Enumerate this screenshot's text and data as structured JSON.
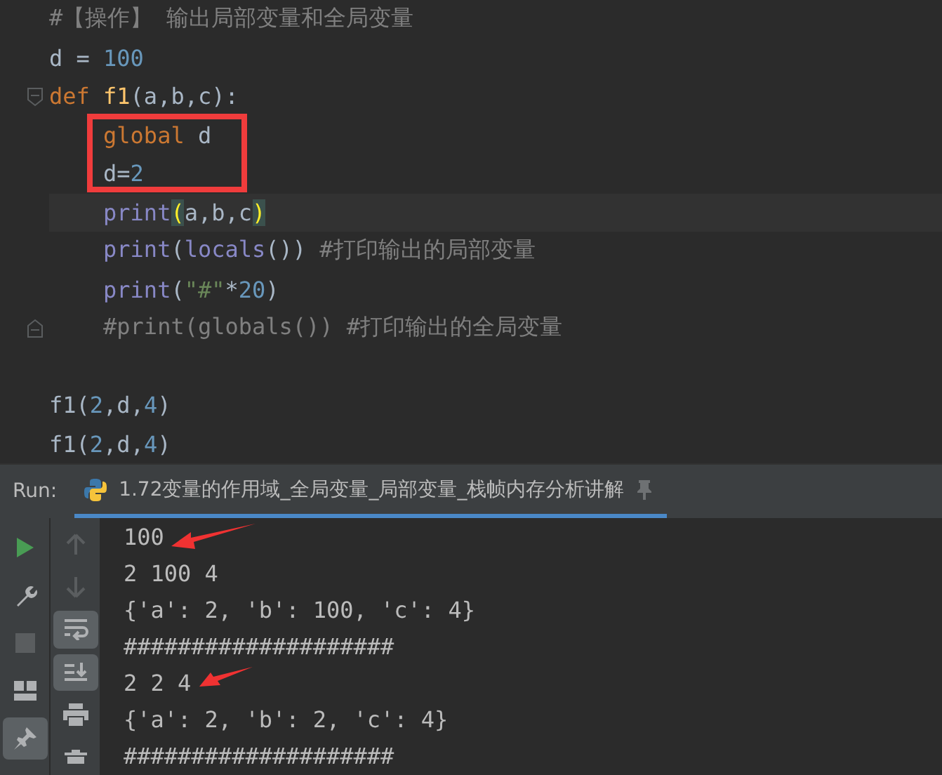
{
  "editor": {
    "lines": [
      {
        "tokens": [
          {
            "text": "#【操作】 输出局部变量和全局变量",
            "kind": "comment"
          }
        ]
      },
      {
        "tokens": [
          {
            "text": "d = ",
            "kind": "plain"
          },
          {
            "text": "100",
            "kind": "number"
          }
        ]
      },
      {
        "fold_start": true,
        "tokens": [
          {
            "text": "def ",
            "kind": "keyword"
          },
          {
            "text": "f1",
            "kind": "funcname"
          },
          {
            "text": "(a,b,c):",
            "kind": "plain"
          }
        ]
      },
      {
        "tokens": [
          {
            "text": "    global ",
            "kind": "keyword"
          },
          {
            "text": "d",
            "kind": "plain"
          }
        ]
      },
      {
        "tokens": [
          {
            "text": "    d=",
            "kind": "plain"
          },
          {
            "text": "2",
            "kind": "number"
          }
        ]
      },
      {
        "current": true,
        "tokens": [
          {
            "text": "    print",
            "kind": "builtin"
          },
          {
            "text": "(",
            "kind": "match"
          },
          {
            "text": "a,b,c",
            "kind": "plain"
          },
          {
            "text": ")",
            "kind": "match"
          }
        ]
      },
      {
        "tokens": [
          {
            "text": "    print",
            "kind": "builtin"
          },
          {
            "text": "(",
            "kind": "plain"
          },
          {
            "text": "locals",
            "kind": "builtin"
          },
          {
            "text": "()) ",
            "kind": "plain"
          },
          {
            "text": "#打印输出的局部变量",
            "kind": "comment"
          }
        ]
      },
      {
        "tokens": [
          {
            "text": "    print",
            "kind": "builtin"
          },
          {
            "text": "(",
            "kind": "plain"
          },
          {
            "text": "\"#\"",
            "kind": "string"
          },
          {
            "text": "*",
            "kind": "plain"
          },
          {
            "text": "20",
            "kind": "number"
          },
          {
            "text": ")",
            "kind": "plain"
          }
        ]
      },
      {
        "fold_end": true,
        "tokens": [
          {
            "text": "    #print(globals()) #打印输出的全局变量",
            "kind": "comment"
          }
        ]
      },
      {
        "blank_before": true,
        "tokens": [
          {
            "text": "f1(",
            "kind": "plain"
          },
          {
            "text": "2",
            "kind": "number"
          },
          {
            "text": ",d,",
            "kind": "plain"
          },
          {
            "text": "4",
            "kind": "number"
          },
          {
            "text": ")",
            "kind": "plain"
          }
        ]
      },
      {
        "tokens": [
          {
            "text": "f1(",
            "kind": "plain"
          },
          {
            "text": "2",
            "kind": "number"
          },
          {
            "text": ",d,",
            "kind": "plain"
          },
          {
            "text": "4",
            "kind": "number"
          },
          {
            "text": ")",
            "kind": "plain"
          }
        ]
      }
    ]
  },
  "run_panel": {
    "label": "Run:",
    "tabs": [
      {
        "title": "1.72变量的作用域_全局变量_局部变量_栈帧内存分析讲解",
        "selected": true
      }
    ],
    "left_toolbar": [
      {
        "selected": false
      },
      {
        "selected": false
      },
      {
        "selected": false
      },
      {
        "selected": false
      },
      {
        "selected": true
      }
    ],
    "right_toolbar": [
      {
        "selected": false
      },
      {
        "selected": false
      },
      {
        "selected": true
      },
      {
        "selected": true
      },
      {
        "selected": false
      },
      {
        "selected": false
      }
    ],
    "output": [
      "100",
      "2 100 4",
      "{'a': 2, 'b': 100, 'c': 4}",
      "####################",
      "2 2 4",
      "{'a': 2, 'b': 2, 'c': 4}",
      "####################"
    ]
  }
}
